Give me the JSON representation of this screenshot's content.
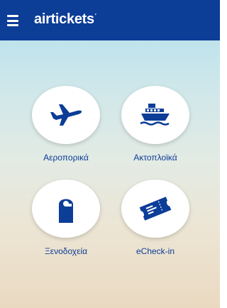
{
  "header": {
    "brand": "airtickets",
    "brand_mark": "'"
  },
  "tiles": [
    {
      "label": "Αεροπορικά",
      "icon": "airplane-icon"
    },
    {
      "label": "Ακτοπλοϊκά",
      "icon": "ship-icon"
    },
    {
      "label": "Ξενοδοχεία",
      "icon": "door-hanger-icon"
    },
    {
      "label": "eCheck-in",
      "icon": "ticket-icon"
    }
  ],
  "colors": {
    "primary": "#0c3d97",
    "appbar": "#0c3d97",
    "circle": "#ffffff"
  }
}
